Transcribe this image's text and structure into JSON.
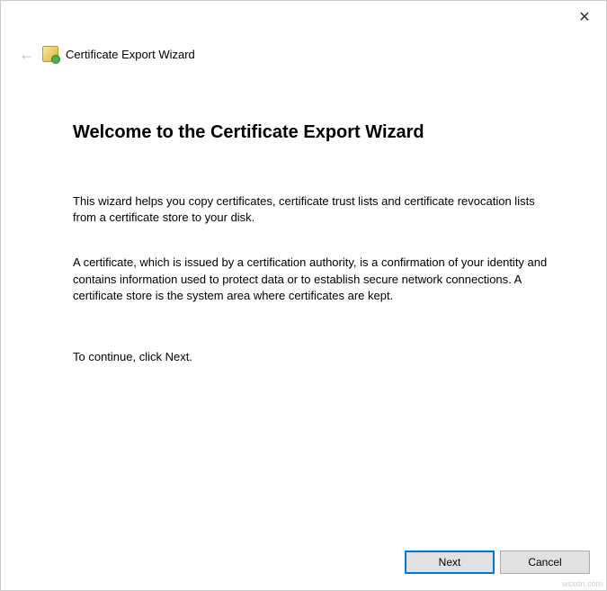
{
  "window": {
    "title": "Certificate Export Wizard"
  },
  "content": {
    "heading": "Welcome to the Certificate Export Wizard",
    "paragraph1": "This wizard helps you copy certificates, certificate trust lists and certificate revocation lists from a certificate store to your disk.",
    "paragraph2": "A certificate, which is issued by a certification authority, is a confirmation of your identity and contains information used to protect data or to establish secure network connections. A certificate store is the system area where certificates are kept.",
    "paragraph3": "To continue, click Next."
  },
  "buttons": {
    "next": "Next",
    "cancel": "Cancel"
  },
  "watermark": "wsxdn.com"
}
